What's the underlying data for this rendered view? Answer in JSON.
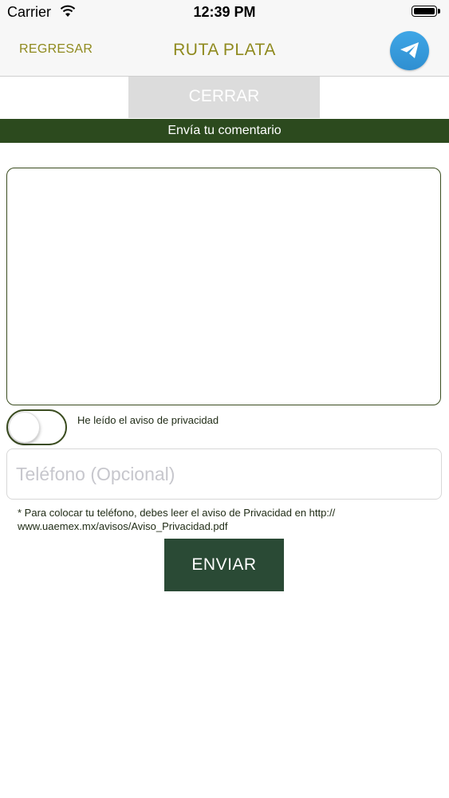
{
  "status_bar": {
    "carrier": "Carrier",
    "time": "12:39 PM"
  },
  "nav": {
    "back_label": "REGRESAR",
    "title": "RUTA PLATA",
    "action_icon": "paper-plane-icon"
  },
  "close_button": {
    "label": "CERRAR"
  },
  "banner": {
    "text": "Envía tu comentario"
  },
  "form": {
    "comment_value": "",
    "privacy_toggle": {
      "label": "He leído el aviso de privacidad",
      "checked": false
    },
    "phone": {
      "placeholder": "Teléfono (Opcional)",
      "value": ""
    },
    "note": "* Para colocar tu teléfono, debes leer el aviso de Privacidad en http://\nwww.uaemex.mx/avisos/Aviso_Privacidad.pdf",
    "submit_label": "ENVIAR"
  },
  "colors": {
    "accent_text": "#8f8a1e",
    "banner_bg": "#2c4a1e",
    "submit_bg": "#2a4a35",
    "fab_bg": "#3fa6e6"
  }
}
